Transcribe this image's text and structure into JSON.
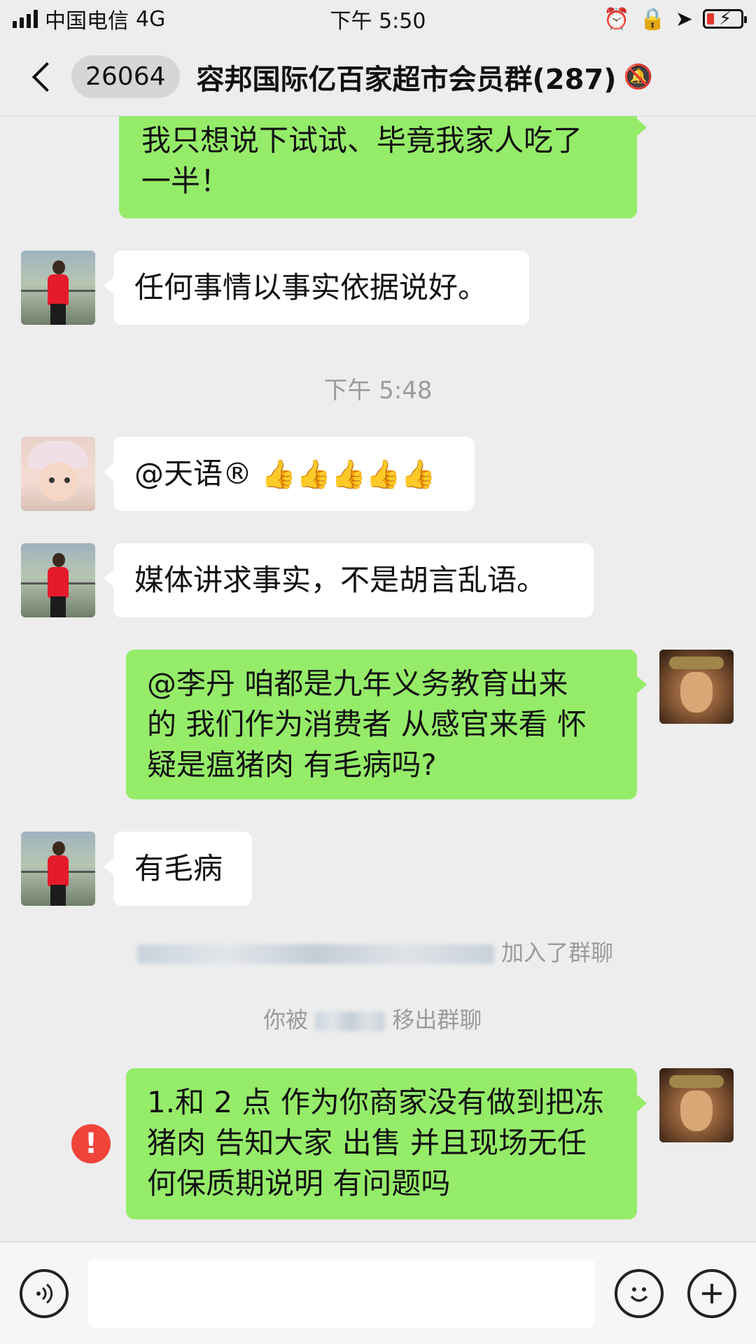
{
  "status_bar": {
    "carrier": "中国电信",
    "network": "4G",
    "time": "下午 5:50"
  },
  "nav": {
    "unread_count": "26064",
    "title": "容邦国际亿百家超市会员群(287)"
  },
  "messages": {
    "m1": {
      "lines": [
        "我只想说下试试、毕竟我家人吃了",
        "一半！"
      ]
    },
    "m2": {
      "text": "任何事情以事实依据说好。"
    },
    "time1": "下午 5:48",
    "m3": {
      "text": "@天语®",
      "emoji": "👍👍👍👍👍"
    },
    "m4": {
      "text": "媒体讲求事实，不是胡言乱语。"
    },
    "m5": {
      "lines": [
        "@李丹 咱都是九年义务教育出来",
        "的 我们作为消费者 从感官来看 怀",
        "疑是瘟猪肉 有毛病吗?"
      ]
    },
    "m6": {
      "text": "有毛病"
    },
    "sys1": {
      "suffix": "加入了群聊"
    },
    "sys2": {
      "prefix": "你被",
      "suffix": "移出群聊"
    },
    "m7": {
      "lines": [
        "1.和 2 点 作为你商家没有做到把冻",
        "猪肉 告知大家 出售 并且现场无任",
        "何保质期说明 有问题吗"
      ]
    }
  },
  "input_bar": {
    "voice_icon": "voice-icon",
    "emoji_icon": "emoji-icon",
    "plus_icon": "plus-icon"
  },
  "colors": {
    "background": "#ededed",
    "outgoing_bubble": "#95ec69",
    "incoming_bubble": "#ffffff",
    "error": "#f0443a"
  }
}
